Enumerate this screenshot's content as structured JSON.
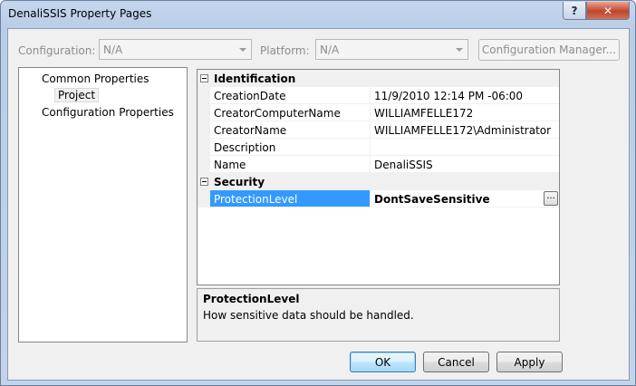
{
  "window": {
    "title": "DenaliSSIS Property Pages",
    "help_label": "?",
    "close_label": "✕"
  },
  "config_bar": {
    "configuration_label": "Configuration:",
    "configuration_value": "N/A",
    "platform_label": "Platform:",
    "platform_value": "N/A",
    "manager_button": "Configuration Manager..."
  },
  "tree": {
    "items": [
      {
        "label": "Common Properties"
      },
      {
        "label": "Project",
        "selected": true
      },
      {
        "label": "Configuration Properties"
      }
    ]
  },
  "property_grid": {
    "categories": [
      {
        "name": "Identification",
        "properties": [
          {
            "name": "CreationDate",
            "value": "11/9/2010 12:14 PM -06:00"
          },
          {
            "name": "CreatorComputerName",
            "value": "WILLIAMFELLE172"
          },
          {
            "name": "CreatorName",
            "value": "WILLIAMFELLE172\\Administrator"
          },
          {
            "name": "Description",
            "value": ""
          },
          {
            "name": "Name",
            "value": "DenaliSSIS"
          }
        ]
      },
      {
        "name": "Security",
        "properties": [
          {
            "name": "ProtectionLevel",
            "value": "DontSaveSensitive",
            "selected": true,
            "ellipsis": "..."
          }
        ]
      }
    ]
  },
  "description": {
    "title": "ProtectionLevel",
    "text": "How sensitive data should be handled."
  },
  "buttons": {
    "ok": "OK",
    "cancel": "Cancel",
    "apply": "Apply"
  },
  "colors": {
    "selection": "#3399ff",
    "panel": "#f0f0f0"
  }
}
